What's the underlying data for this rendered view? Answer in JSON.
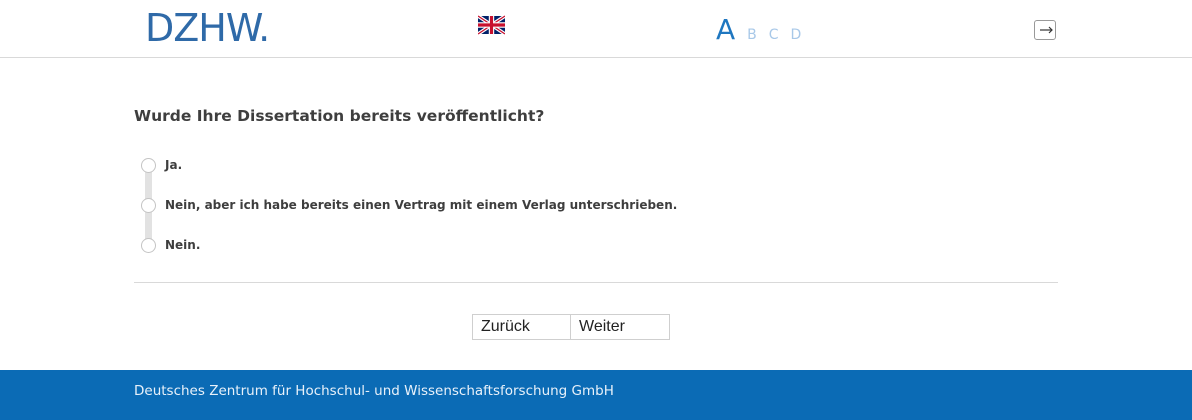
{
  "header": {
    "logo_text": "DZHW.",
    "language_icon": "uk-flag-icon",
    "font_size": {
      "large": "A",
      "options": [
        "B",
        "C",
        "D"
      ]
    },
    "logout_icon": "logout-icon"
  },
  "question": {
    "text": "Wurde Ihre Dissertation bereits veröffentlicht?",
    "options": [
      "Ja.",
      "Nein, aber ich habe bereits einen Vertrag mit einem Verlag unterschrieben.",
      "Nein."
    ]
  },
  "navigation": {
    "back_label": "Zurück",
    "next_label": "Weiter"
  },
  "footer": {
    "text": "Deutsches Zentrum für Hochschul- und Wissenschaftsforschung GmbH"
  },
  "colors": {
    "brand_blue": "#2f6aa8",
    "footer_blue": "#0b6bb5"
  }
}
